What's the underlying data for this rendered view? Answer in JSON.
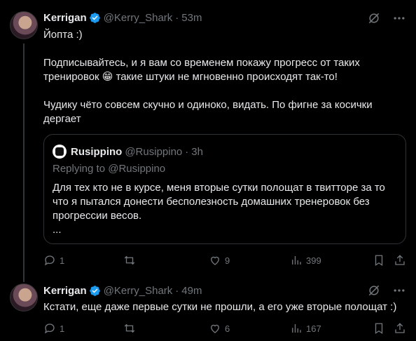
{
  "tweets": [
    {
      "author": "Kerrigan",
      "handle": "@Kerry_Shark",
      "time": "53m",
      "text": "Йопта :)\n\nПодписывайтесь, и я вам со временем покажу прогресс от таких тренировок 😁 такие штуки не мгновенно происходят так-то!\n\nЧудику чёто совсем скучно и одиноко, видать. По фигне за косички дергает",
      "quote": {
        "author": "Rusippino",
        "handle": "@Rusippino",
        "time": "3h",
        "replying_to": "Replying to @Rusippino",
        "text": "Для тех кто не в курсе, меня вторые сутки полощат в твитторе за то что я пытался донести бесполезность домашних тренеровок без прогрессии весов.\n..."
      },
      "stats": {
        "replies": "1",
        "retweets": "",
        "likes": "9",
        "views": "399"
      }
    },
    {
      "author": "Kerrigan",
      "handle": "@Kerry_Shark",
      "time": "49m",
      "text": "Кстати, еще даже первые сутки не прошли, а его уже вторые полощат :)",
      "stats": {
        "replies": "1",
        "retweets": "",
        "likes": "6",
        "views": "167"
      }
    }
  ],
  "separator": "·",
  "colors": {
    "background": "#000000",
    "text": "#e7e9ea",
    "muted": "#71767b",
    "verified": "#1d9bf0",
    "border": "#2f3336"
  }
}
